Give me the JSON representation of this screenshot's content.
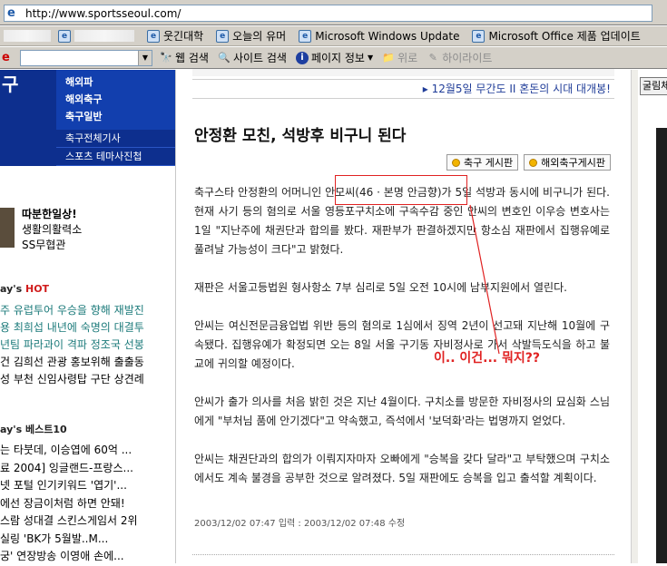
{
  "browser": {
    "url": "http://www.sportsseoul.com/",
    "links": [
      {
        "label": "웃긴대학",
        "icon": "ie-page-icon"
      },
      {
        "label": "오늘의 유머",
        "icon": "ie-page-icon"
      },
      {
        "label": "Microsoft Windows Update",
        "icon": "ie-page-icon"
      },
      {
        "label": "Microsoft Office 제품 업데이트",
        "icon": "ie-page-icon"
      }
    ],
    "toolbar": {
      "web_search": "웹 검색",
      "site_search": "사이트 검색",
      "page_info": "페이지 정보",
      "up": "위로",
      "highlight": "하이라이트"
    }
  },
  "left": {
    "nav": [
      "해외파",
      "해외축구",
      "축구일반"
    ],
    "subnav": [
      "축구전체기사",
      "스포츠 테마사진첩"
    ],
    "promo": {
      "line1": "따분한일상!",
      "line2": "생활의활력소",
      "line3": "SS무협관"
    },
    "hot_title_prefix": "ay's ",
    "hot_title_hot": "HOT",
    "hot_items": [
      "주 유럽투어 우승을 향해 재발진",
      "용 최희섭 내년에 숙명의 대결투",
      "년팀 파라과이 격파 정조국 선봉",
      "건 김희선 관광 홍보위해 출출동",
      "성 부천 신임사령탑 구단 상견례"
    ],
    "best_title": "ay's 베스트10",
    "best_items": [
      "는 타붓데, 이승엽에 60억 ...",
      "료 2004] 잉글랜드-프랑스...",
      "넷 포털 인기키워드 '엽기'...",
      "에선 장금이처럼 하면 안돼!",
      "스람 성대결 스킨스게임서 2위",
      "실링 'BK가 5월발..M...",
      "궁' 연장방송 이영애 손에..."
    ]
  },
  "article": {
    "ticker": "▸ 12월5일 무간도 II 혼돈의 시대 대개봉!",
    "headline": "안정환 모친, 석방후 비구니 된다",
    "boards": [
      "축구 게시판",
      "해외축구게시판"
    ],
    "paragraphs": [
      "축구스타 안정환의 어머니인 안모씨(46 · 본명 안금향)가 5일 석방과 동시에 비구니가 된다. 현재 사기 등의 혐의로 서울 영등포구치소에 구속수감 중인 안씨의 변호인 이우승 변호사는 1일 \"지난주에 채권단과 합의를 봤다. 재판부가 판결하겠지만 항소심 재판에서 집행유예로 풀려날 가능성이 크다\"고 밝혔다.",
      "재판은 서울고등법원 형사항소 7부 심리로 5일 오전 10시에 남부지원에서 열린다.",
      "안씨는 여신전문금융업법 위반 등의 혐의로 1심에서 징역 2년이 선고돼 지난해 10월에 구속됐다. 집행유예가 확정되면 오는 8일 서울 구기동 자비정사로 가서 삭발득도식을 하고 불교에 귀의할 예정이다.",
      "안씨가 출가 의사를 처음 밝힌 것은 지난 4월이다. 구치소를 방문한 자비정사의 묘심화 스님에게 \"부처님 품에 안기겠다\"고 약속했고, 즉석에서 '보덕화'라는 법명까지 얻었다.",
      "안씨는 채권단과의 합의가 이뤄지자마자 오빠에게 \"승복을 갖다 달라\"고 부탁했으며 구치소에서도 계속 불경을 공부한 것으로 알려졌다. 5일 재판에도 승복을 입고 출석할 계획이다."
    ],
    "meta": "2003/12/02 07:47 입력 : 2003/12/02 07:48 수정",
    "annotation": "이.. 이건... 뭐지??"
  },
  "right": {
    "search_label": "굴림체"
  }
}
